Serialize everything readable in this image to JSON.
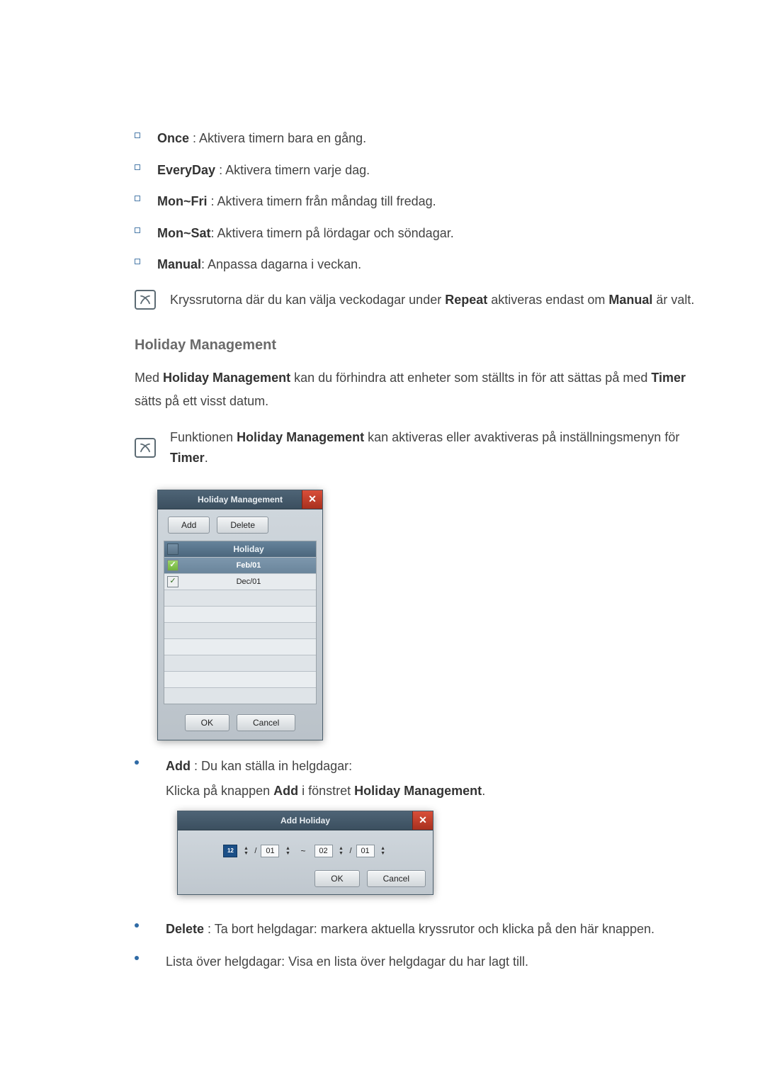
{
  "repeat_options": [
    {
      "label": "Once",
      "desc": " : Aktivera timern bara en gång."
    },
    {
      "label": "EveryDay",
      "desc": " : Aktivera timern varje dag."
    },
    {
      "label": "Mon~Fri",
      "desc": " : Aktivera timern från måndag till fredag."
    },
    {
      "label": "Mon~Sat",
      "desc": ": Aktivera timern på lördagar och söndagar."
    },
    {
      "label": "Manual",
      "desc": ": Anpassa dagarna i veckan."
    }
  ],
  "note1": {
    "pre": "Kryssrutorna där du kan välja veckodagar under ",
    "b1": "Repeat",
    "mid": " aktiveras endast om ",
    "b2": "Manual",
    "post": " är valt."
  },
  "section_heading": "Holiday Management",
  "hm_para": {
    "pre": "Med ",
    "b1": "Holiday Management",
    "mid": " kan du förhindra att enheter som ställts in för att sättas på med ",
    "b2": "Timer",
    "post": " sätts på ett visst datum."
  },
  "note2": {
    "pre": "Funktionen ",
    "b1": "Holiday Management",
    "mid": " kan aktiveras eller avaktiveras på inställningsmenyn för ",
    "b2": "Timer",
    "post": "."
  },
  "dlg1": {
    "title": "Holiday Management",
    "add": "Add",
    "delete": "Delete",
    "col": "Holiday",
    "rows": [
      "Feb/01",
      "Dec/01"
    ],
    "ok": "OK",
    "cancel": "Cancel"
  },
  "bullets": {
    "add": {
      "label": "Add",
      "desc": " : Du kan ställa in helgdagar:",
      "sub_pre": "Klicka på knappen ",
      "sub_b1": "Add",
      "sub_mid": " i fönstret ",
      "sub_b2": "Holiday Management",
      "sub_post": "."
    },
    "delete": {
      "label": "Delete",
      "desc": " : Ta bort helgdagar: markera aktuella kryssrutor och klicka på den här knappen."
    },
    "list": {
      "text": "Lista över helgdagar: Visa en lista över helgdagar du har lagt till."
    }
  },
  "dlg2": {
    "title": "Add Holiday",
    "cal_badge": "12",
    "m1": "01",
    "d1": "",
    "sep": "~",
    "m2": "02",
    "d2": "01",
    "ok": "OK",
    "cancel": "Cancel"
  }
}
